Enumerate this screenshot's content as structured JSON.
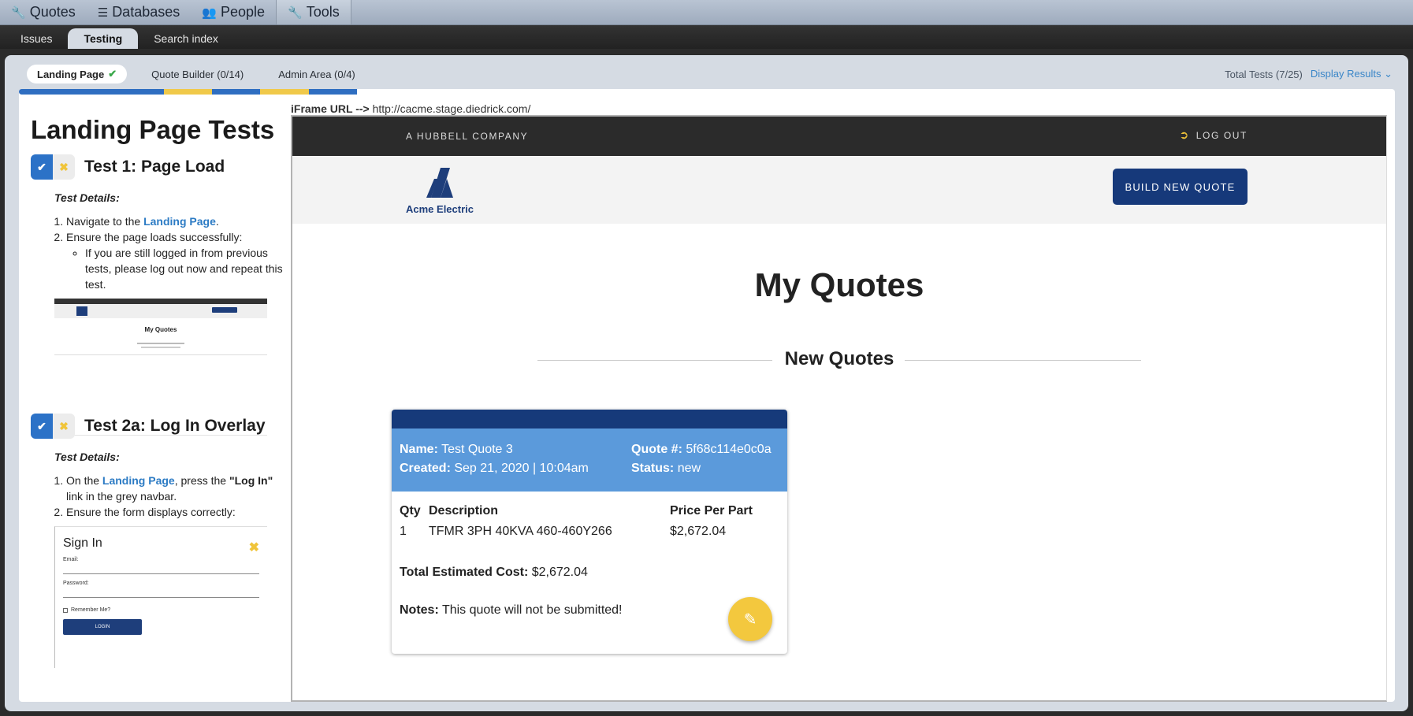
{
  "topnav": {
    "items": [
      {
        "label": "Quotes",
        "icon": "wrench-icon"
      },
      {
        "label": "Databases",
        "icon": "database-icon"
      },
      {
        "label": "People",
        "icon": "users-icon"
      },
      {
        "label": "Tools",
        "icon": "wrench-icon",
        "active": true
      }
    ]
  },
  "subnav": {
    "items": [
      {
        "label": "Issues"
      },
      {
        "label": "Testing",
        "active": true
      },
      {
        "label": "Search index"
      }
    ]
  },
  "tabs": {
    "items": [
      {
        "label": "Landing Page",
        "active": true,
        "completed": true
      },
      {
        "label": "Quote Builder (0/14)"
      },
      {
        "label": "Admin Area (0/4)"
      }
    ],
    "total": "Total Tests (7/25)",
    "display": "Display Results"
  },
  "progress": {
    "segments": [
      {
        "color": "#2f6ec1",
        "fraction": 0.375
      },
      {
        "color": "#f0c94a",
        "fraction": 0.125
      },
      {
        "color": "#2f6ec1",
        "fraction": 0.125
      },
      {
        "color": "#f0c94a",
        "fraction": 0.125
      },
      {
        "color": "#2f6ec1",
        "fraction": 0.125
      }
    ]
  },
  "left": {
    "title": "Landing Page Tests",
    "test1": {
      "title": "Test 1: Page Load",
      "details_label": "Test Details:",
      "step1_prefix": "Navigate to the ",
      "step1_link": "Landing Page",
      "step1_suffix": ".",
      "step2": "Ensure the page loads successfully:",
      "substep": "If you are still logged in from previous tests, please log out now and repeat this test.",
      "thumb_title": "My Quotes"
    },
    "test2": {
      "title": "Test 2a: Log In Overlay",
      "details_label": "Test Details:",
      "step1_prefix": "On the ",
      "step1_link": "Landing Page",
      "step1_mid": ", press the ",
      "step1_bold": "\"Log In\"",
      "step1_suffix": " link in the grey navbar.",
      "step2": "Ensure the form displays correctly:",
      "thumb": {
        "title": "Sign In",
        "email": "Email:",
        "password": "Password:",
        "remember": "Remember Me?",
        "login": "LOGIN"
      }
    }
  },
  "iframe": {
    "url_label": "iFrame URL -->",
    "url": "http://cacme.stage.diedrick.com/",
    "company": "A HUBBELL COMPANY",
    "logout": "LOG OUT",
    "logo_text": "Acme Electric",
    "build_button": "BUILD NEW QUOTE",
    "heading": "My Quotes",
    "section": "New Quotes",
    "card": {
      "name_label": "Name:",
      "name": "Test Quote 3",
      "created_label": "Created:",
      "created": "Sep 21, 2020 | 10:04am",
      "quote_label": "Quote #:",
      "quote": "5f68c114e0c0a",
      "status_label": "Status:",
      "status": "new",
      "col_qty": "Qty",
      "col_desc": "Description",
      "col_price": "Price Per Part",
      "row_qty": "1",
      "row_desc": "TFMR 3PH 40KVA 460-460Y266",
      "row_price": "$2,672.04",
      "total_label": "Total Estimated Cost:",
      "total": "$2,672.04",
      "notes_label": "Notes:",
      "notes": "This quote will not be submitted!"
    }
  }
}
